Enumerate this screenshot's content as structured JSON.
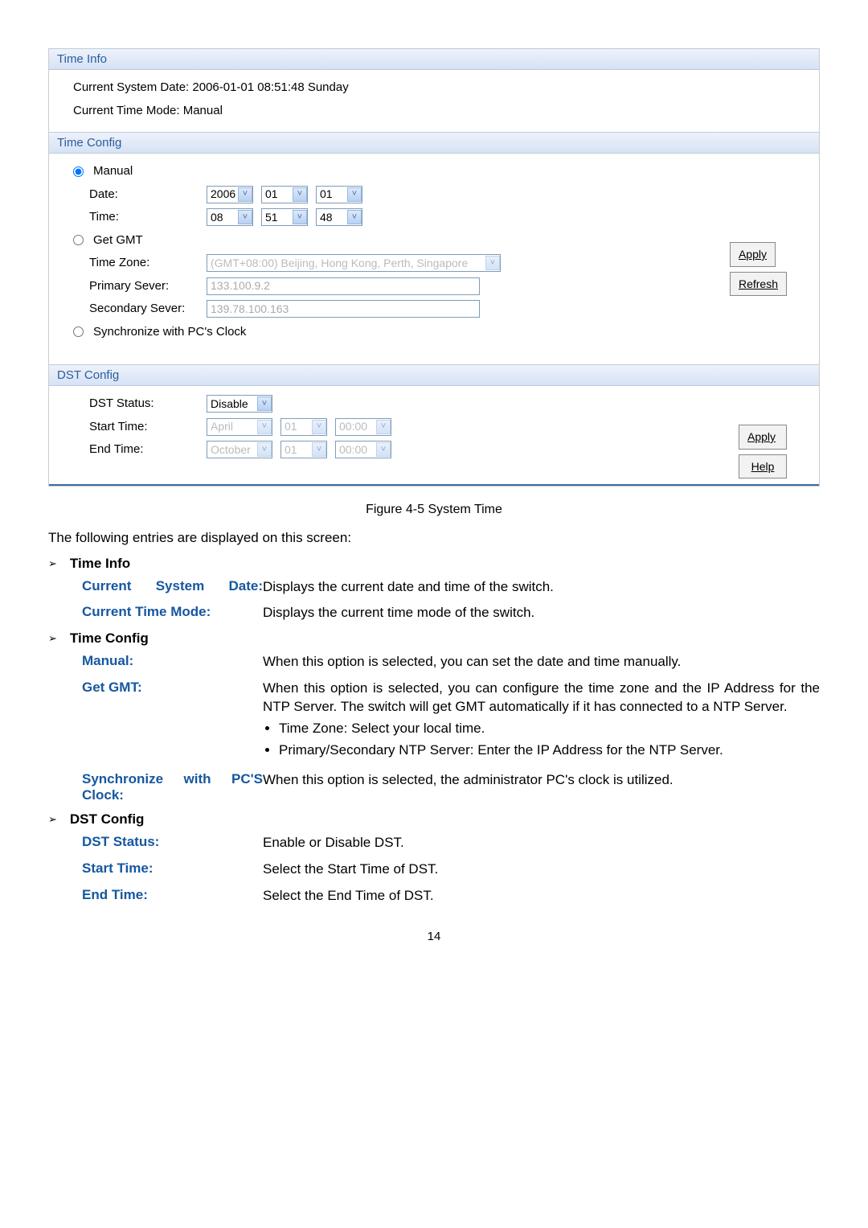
{
  "panel": {
    "timeInfo": {
      "header": "Time Info",
      "currentDateLine": "Current System Date:   2006-01-01    08:51:48    Sunday",
      "modeLine": "Current Time Mode:   Manual"
    },
    "timeConfig": {
      "header": "Time Config",
      "manual": "Manual",
      "dateLabel": "Date:",
      "date": {
        "year": "2006",
        "month": "01",
        "day": "01"
      },
      "timeLabel": "Time:",
      "time": {
        "h": "08",
        "m": "51",
        "s": "48"
      },
      "getGmt": "Get GMT",
      "tzLabel": "Time Zone:",
      "tzValue": "(GMT+08:00) Beijing, Hong Kong, Perth, Singapore",
      "primaryLabel": "Primary Sever:",
      "primaryValue": "133.100.9.2",
      "secondaryLabel": "Secondary Sever:",
      "secondaryValue": "139.78.100.163",
      "syncPc": "Synchronize with PC's Clock",
      "applyBtn": "Apply",
      "refreshBtn": "Refresh"
    },
    "dstConfig": {
      "header": "DST Config",
      "statusLabel": "DST Status:",
      "statusValue": "Disable",
      "startLabel": "Start Time:",
      "start": {
        "month": "April",
        "day": "01",
        "time": "00:00"
      },
      "endLabel": "End Time:",
      "end": {
        "month": "October",
        "day": "01",
        "time": "00:00"
      },
      "applyBtn": "Apply",
      "helpBtn": "Help"
    }
  },
  "caption": "Figure 4-5 System Time",
  "intro": "The following entries are displayed on this screen:",
  "sections": {
    "timeInfo": {
      "heading": "Time Info",
      "rows": [
        {
          "term": "Current System Date:",
          "termJustify": true,
          "def": "Displays the current date and time of the switch."
        },
        {
          "term": "Current Time Mode:",
          "def": "Displays the current time mode of the switch."
        }
      ]
    },
    "timeConfig": {
      "heading": "Time Config",
      "rows": [
        {
          "term": "Manual:",
          "def": "When this option is selected, you can set the date and time manually.",
          "defJustify": true
        },
        {
          "term": "Get GMT:",
          "def": "When this option is selected, you can configure the time zone and the IP Address for the NTP Server. The switch will get GMT automatically if it has connected to a NTP Server.",
          "defJustify": true,
          "bullets": [
            "Time Zone: Select your local time.",
            "Primary/Secondary NTP Server: Enter the IP Address for the NTP Server."
          ]
        },
        {
          "term": "Synchronize with PC'S Clock:",
          "termJustify": true,
          "def": "When this option is selected, the administrator PC's clock is utilized.",
          "defJustify": true
        }
      ]
    },
    "dstConfig": {
      "heading": "DST Config",
      "rows": [
        {
          "term": "DST Status:",
          "def": "Enable or Disable DST."
        },
        {
          "term": "Start Time:",
          "def": "Select the Start Time of DST."
        },
        {
          "term": "End Time:",
          "def": "Select the End Time of DST."
        }
      ]
    }
  },
  "pageNumber": "14"
}
